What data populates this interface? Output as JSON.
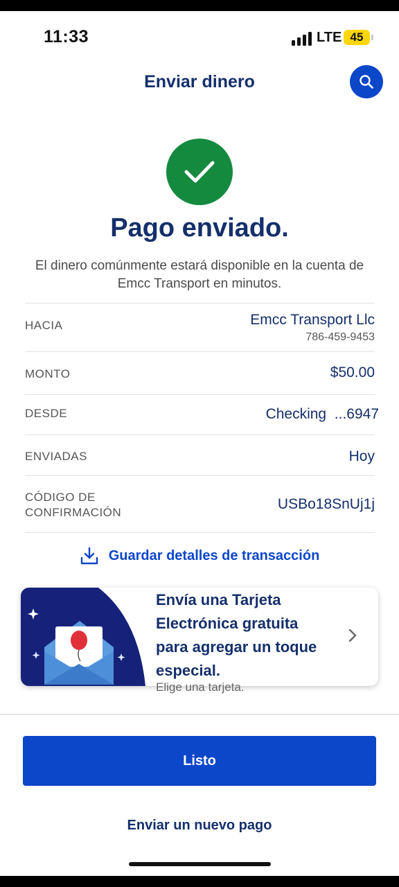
{
  "status_bar": {
    "time": "11:33",
    "network": "LTE",
    "battery": "45",
    "battery_color": "#ffd60a"
  },
  "header": {
    "title": "Enviar dinero",
    "search_icon": "search-icon"
  },
  "success": {
    "icon": "check-icon",
    "title": "Pago enviado.",
    "subtitle": "El dinero comúnmente estará disponible en la cuenta de Emcc Transport en minutos."
  },
  "details": [
    {
      "label": "HACIA",
      "value": "Emcc Transport Llc",
      "sub": "786-459-9453"
    },
    {
      "label": "MONTO",
      "value": "$50.00"
    },
    {
      "label": "DESDE",
      "value": "Checking  ...6947"
    },
    {
      "label": "ENVIADAS",
      "value": "Hoy"
    },
    {
      "label": "CÓDIGO DE CONFIRMACIÓN",
      "value": "USBo18SnUj1j"
    }
  ],
  "save_link": {
    "label": "Guardar detalles de transacción",
    "icon": "download-icon"
  },
  "promo": {
    "text": "Envía una Tarjeta Electrónica gratuita para agregar un toque especial.",
    "cta": "Elige una tarjeta.",
    "art_icon": "envelope-balloon-illustration",
    "chevron_icon": "chevron-right-icon"
  },
  "actions": {
    "done": "Listo",
    "new_payment": "Enviar un nuevo pago"
  },
  "colors": {
    "brand_blue": "#0c46c9",
    "navy": "#152f6b",
    "success_green": "#148a3f"
  }
}
